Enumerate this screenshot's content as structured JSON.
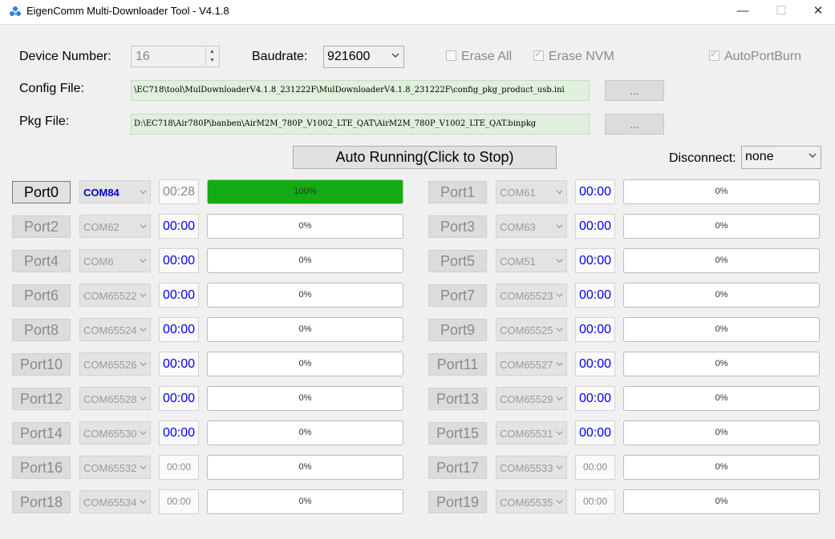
{
  "window": {
    "title": "EigenComm Multi-Downloader Tool - V4.1.8",
    "minimize": "—",
    "maximize": "☐",
    "close": "✕"
  },
  "settings": {
    "device_number_label": "Device Number:",
    "device_number_value": "16",
    "baudrate_label": "Baudrate:",
    "baudrate_value": "921600",
    "erase_all_label": "Erase All",
    "erase_all_checked": false,
    "erase_nvm_label": "Erase NVM",
    "erase_nvm_checked": true,
    "autoportburn_label": "AutoPortBurn",
    "autoportburn_checked": true,
    "config_file_label": "Config File:",
    "config_file_path": "\\EC718\\tool\\MulDownloaderV4.1.8_231222F\\MulDownloaderV4.1.8_231222F\\config_pkg_product_usb.ini",
    "pkg_file_label": "Pkg File:",
    "pkg_file_path": "D:\\EC718\\Air780P\\banben\\AirM2M_780P_V1002_LTE_QAT\\AirM2M_780P_V1002_LTE_QAT.binpkg",
    "browse_label": "...",
    "disconnect_label": "Disconnect:",
    "disconnect_value": "none"
  },
  "run_button_label": "Auto Running(Click to Stop)",
  "ports": [
    {
      "name": "Port0",
      "com": "COM84",
      "time": "00:28",
      "progress": "100%",
      "fill": 1.0,
      "active": true
    },
    {
      "name": "Port1",
      "com": "COM61",
      "time": "00:00",
      "progress": "0%",
      "fill": 0
    },
    {
      "name": "Port2",
      "com": "COM62",
      "time": "00:00",
      "progress": "0%",
      "fill": 0
    },
    {
      "name": "Port3",
      "com": "COM63",
      "time": "00:00",
      "progress": "0%",
      "fill": 0
    },
    {
      "name": "Port4",
      "com": "COM6",
      "time": "00:00",
      "progress": "0%",
      "fill": 0
    },
    {
      "name": "Port5",
      "com": "COM51",
      "time": "00:00",
      "progress": "0%",
      "fill": 0
    },
    {
      "name": "Port6",
      "com": "COM65522",
      "time": "00:00",
      "progress": "0%",
      "fill": 0
    },
    {
      "name": "Port7",
      "com": "COM65523",
      "time": "00:00",
      "progress": "0%",
      "fill": 0
    },
    {
      "name": "Port8",
      "com": "COM65524",
      "time": "00:00",
      "progress": "0%",
      "fill": 0
    },
    {
      "name": "Port9",
      "com": "COM65525",
      "time": "00:00",
      "progress": "0%",
      "fill": 0
    },
    {
      "name": "Port10",
      "com": "COM65526",
      "time": "00:00",
      "progress": "0%",
      "fill": 0
    },
    {
      "name": "Port11",
      "com": "COM65527",
      "time": "00:00",
      "progress": "0%",
      "fill": 0
    },
    {
      "name": "Port12",
      "com": "COM65528",
      "time": "00:00",
      "progress": "0%",
      "fill": 0
    },
    {
      "name": "Port13",
      "com": "COM65529",
      "time": "00:00",
      "progress": "0%",
      "fill": 0
    },
    {
      "name": "Port14",
      "com": "COM65530",
      "time": "00:00",
      "progress": "0%",
      "fill": 0
    },
    {
      "name": "Port15",
      "com": "COM65531",
      "time": "00:00",
      "progress": "0%",
      "fill": 0
    },
    {
      "name": "Port16",
      "com": "COM65532",
      "time": "00:00",
      "progress": "0%",
      "fill": 0,
      "small_time": true
    },
    {
      "name": "Port17",
      "com": "COM65533",
      "time": "00:00",
      "progress": "0%",
      "fill": 0,
      "small_time": true
    },
    {
      "name": "Port18",
      "com": "COM65534",
      "time": "00:00",
      "progress": "0%",
      "fill": 0,
      "small_time": true
    },
    {
      "name": "Port19",
      "com": "COM65535",
      "time": "00:00",
      "progress": "0%",
      "fill": 0,
      "small_time": true
    }
  ],
  "colors": {
    "progress_fill": "#12ab12",
    "timer_blue": "#0000ff",
    "active_com": "#0000c8"
  },
  "icons": {
    "app": "eigencomm-logo-icon",
    "dropdown": "chevron-down-icon",
    "spin_up": "spin-up-icon",
    "spin_down": "spin-down-icon"
  }
}
